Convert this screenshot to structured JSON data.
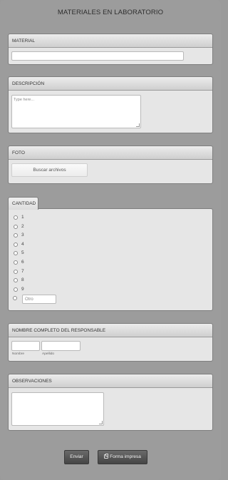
{
  "form": {
    "title": "MATERIALES EN LABORATORIO"
  },
  "material": {
    "label": "MATERIAL",
    "value": ""
  },
  "descripcion": {
    "label": "DESCRIPCIÓN",
    "placeholder": "Type here..."
  },
  "foto": {
    "label": "FOTO",
    "button": "Buscar archivos"
  },
  "cantidad": {
    "label": "CANTIDAD",
    "options": [
      "1",
      "2",
      "3",
      "4",
      "5",
      "6",
      "7",
      "8",
      "9"
    ],
    "other_placeholder": "Otro"
  },
  "responsable": {
    "label": "NOMBRE COMPLETO DEL RESPONSABLE",
    "nombre_sublabel": "Nombre",
    "apellido_sublabel": "Apellido"
  },
  "observaciones": {
    "label": "OBSERVACIONES",
    "value": ""
  },
  "actions": {
    "submit": "Enviar",
    "print": "Forma impresa"
  }
}
